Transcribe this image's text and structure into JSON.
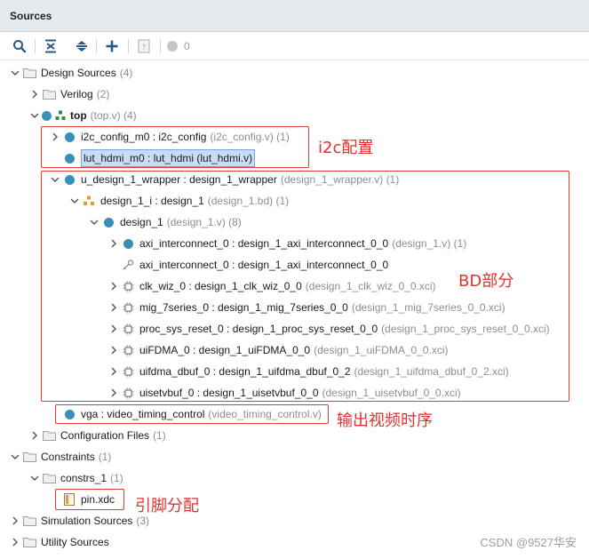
{
  "panel": {
    "title": "Sources"
  },
  "toolbar": {
    "counter_value": "0"
  },
  "tree": [
    {
      "id": "design-sources",
      "label": "Design Sources",
      "meta": "(4)"
    },
    {
      "id": "verilog",
      "label": "Verilog",
      "meta": "(2)"
    },
    {
      "id": "top",
      "label": "top",
      "meta": "(top.v) (4)"
    },
    {
      "id": "i2c-config",
      "label": "i2c_config_m0 : i2c_config",
      "meta": "(i2c_config.v) (1)"
    },
    {
      "id": "lut-hdmi",
      "label": "lut_hdmi_m0 : lut_hdmi (lut_hdmi.v)",
      "meta": ""
    },
    {
      "id": "u-design-wrapper",
      "label": "u_design_1_wrapper : design_1_wrapper",
      "meta": "(design_1_wrapper.v) (1)"
    },
    {
      "id": "design-1-i",
      "label": "design_1_i : design_1",
      "meta": "(design_1.bd) (1)"
    },
    {
      "id": "design-1",
      "label": "design_1",
      "meta": "(design_1.v) (8)"
    },
    {
      "id": "axi-interconnect-a",
      "label": "axi_interconnect_0 : design_1_axi_interconnect_0_0",
      "meta": "(design_1.v) (1)"
    },
    {
      "id": "axi-interconnect-b",
      "label": "axi_interconnect_0 : design_1_axi_interconnect_0_0",
      "meta": ""
    },
    {
      "id": "clk-wiz",
      "label": "clk_wiz_0 : design_1_clk_wiz_0_0",
      "meta": "(design_1_clk_wiz_0_0.xci)"
    },
    {
      "id": "mig-7series",
      "label": "mig_7series_0 : design_1_mig_7series_0_0",
      "meta": "(design_1_mig_7series_0_0.xci)"
    },
    {
      "id": "proc-sys-reset",
      "label": "proc_sys_reset_0 : design_1_proc_sys_reset_0_0",
      "meta": "(design_1_proc_sys_reset_0_0.xci)"
    },
    {
      "id": "uifdma",
      "label": "uiFDMA_0 : design_1_uiFDMA_0_0",
      "meta": "(design_1_uiFDMA_0_0.xci)"
    },
    {
      "id": "uifdma-dbuf",
      "label": "uifdma_dbuf_0 : design_1_uifdma_dbuf_0_2",
      "meta": "(design_1_uifdma_dbuf_0_2.xci)"
    },
    {
      "id": "uisetvbuf",
      "label": "uisetvbuf_0 : design_1_uisetvbuf_0_0",
      "meta": "(design_1_uisetvbuf_0_0.xci)"
    },
    {
      "id": "vga",
      "label": "vga : video_timing_control",
      "meta": "(video_timing_control.v)"
    },
    {
      "id": "config-files",
      "label": "Configuration Files",
      "meta": "(1)"
    },
    {
      "id": "constraints",
      "label": "Constraints",
      "meta": "(1)"
    },
    {
      "id": "constrs-1",
      "label": "constrs_1",
      "meta": "(1)"
    },
    {
      "id": "pin-xdc",
      "label": "pin.xdc",
      "meta": ""
    },
    {
      "id": "sim-sources",
      "label": "Simulation Sources",
      "meta": "(3)"
    },
    {
      "id": "utility-sources",
      "label": "Utility Sources",
      "meta": ""
    }
  ],
  "annotations": {
    "i2c": "i2c配置",
    "bd": "BD部分",
    "video": "输出视频时序",
    "pin": "引脚分配"
  },
  "watermark": "CSDN @9527华安",
  "colors": {
    "annotation_red": "#e03a3a",
    "module_dot": "#3a8fb7",
    "selection": "#c9dcf5"
  }
}
